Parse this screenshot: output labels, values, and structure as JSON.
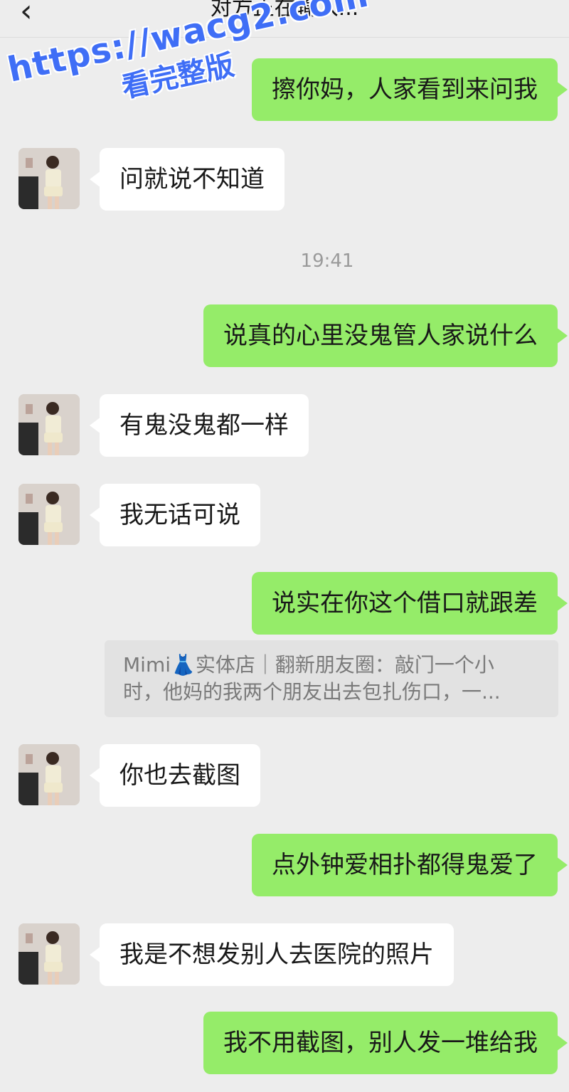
{
  "header": {
    "back_icon": "chevron-left-icon",
    "title": "对方正在输入..."
  },
  "watermark": {
    "url": "https://wacg2.com",
    "text": "看完整版"
  },
  "timestamp": "19:41",
  "messages": [
    {
      "side": "right",
      "text": "擦你妈，人家看到来问我"
    },
    {
      "side": "left",
      "text": "问就说不知道"
    },
    {
      "side": "right",
      "text": "说真的心里没鬼管人家说什么"
    },
    {
      "side": "left",
      "text": "有鬼没鬼都一样"
    },
    {
      "side": "left",
      "text": "我无话可说"
    },
    {
      "side": "right",
      "text": "说实在你这个借口就跟差"
    },
    {
      "side": "left",
      "text": "你也去截图"
    },
    {
      "side": "right",
      "text": "点外钟爱相扑都得鬼爱了"
    },
    {
      "side": "left",
      "text": "我是不想发别人去医院的照片"
    },
    {
      "side": "right",
      "text": "我不用截图，别人发一堆给我"
    }
  ],
  "quote": {
    "line1": "Mimi👗实体店｜翻新朋友圈：敲门一个小",
    "line2": "时，他妈的我两个朋友出去包扎伤口，一..."
  },
  "colors": {
    "background": "#ededed",
    "sent_bubble": "#95ec69",
    "received_bubble": "#ffffff",
    "watermark": "#3f6ef6"
  }
}
